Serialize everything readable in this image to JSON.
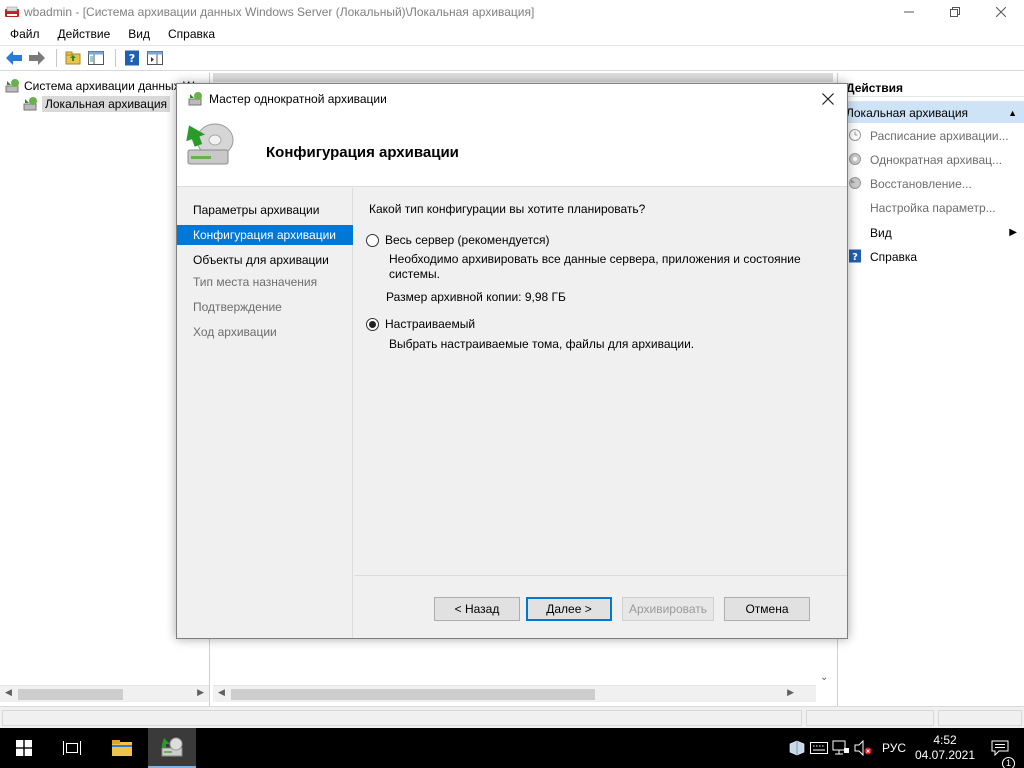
{
  "window": {
    "title": "wbadmin - [Система архивации данных Windows Server (Локальный)\\Локальная архивация]",
    "app_icon": "wbadmin-icon"
  },
  "menu": [
    "Файл",
    "Действие",
    "Вид",
    "Справка"
  ],
  "tree": {
    "root": "Система архивации данных W",
    "child": "Локальная архивация"
  },
  "actions": {
    "title": "Действия",
    "section": "Локальная архивация",
    "items": [
      {
        "label": "Расписание архивации...",
        "enabled": false
      },
      {
        "label": "Однократная архивац...",
        "enabled": false
      },
      {
        "label": "Восстановление...",
        "enabled": false
      },
      {
        "label": "Настройка параметр...",
        "enabled": false
      },
      {
        "label": "Вид",
        "enabled": true
      },
      {
        "label": "Справка",
        "enabled": true
      }
    ]
  },
  "dialog": {
    "title": "Мастер однократной архивации",
    "header_title": "Конфигурация архивации",
    "steps": [
      {
        "label": "Параметры архивации",
        "state": "done"
      },
      {
        "label": "Конфигурация архивации",
        "state": "current"
      },
      {
        "label": "Объекты для архивации",
        "state": "done"
      },
      {
        "label": "Тип места назначения",
        "state": "future"
      },
      {
        "label": "Подтверждение",
        "state": "future"
      },
      {
        "label": "Ход архивации",
        "state": "future"
      }
    ],
    "question": "Какой тип конфигурации вы хотите планировать?",
    "option_full": {
      "label": "Весь сервер (рекомендуется)",
      "description": "Необходимо архивировать все данные сервера, приложения и состояние системы.",
      "size_text": "Размер архивной копии: 9,98 ГБ",
      "selected": false
    },
    "option_custom": {
      "label": "Настраиваемый",
      "description": "Выбрать настраиваемые тома, файлы для архивации.",
      "selected": true
    },
    "buttons": {
      "back": "< Назад",
      "next": "Далее >",
      "backup": "Архивировать",
      "cancel": "Отмена"
    }
  },
  "taskbar": {
    "language": "РУС",
    "time": "4:52",
    "date": "04.07.2021",
    "notification_count": "1"
  },
  "colors": {
    "accent": "#0078d7",
    "actions_section_bg": "#cfe3f7"
  }
}
